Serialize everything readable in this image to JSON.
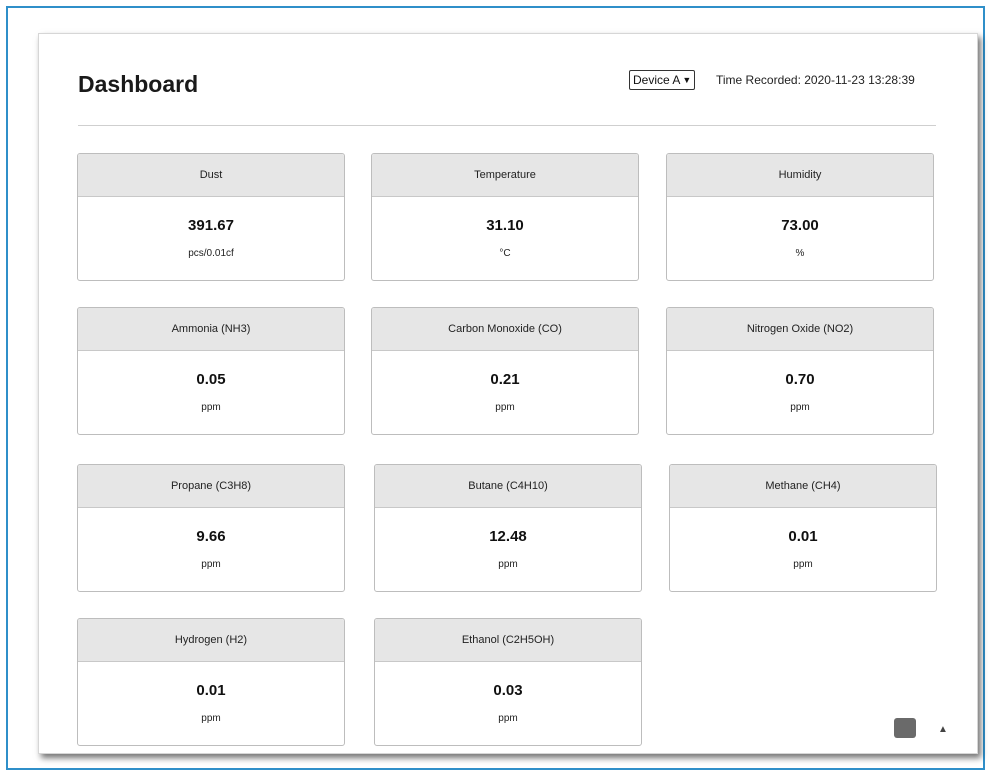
{
  "page": {
    "title": "Dashboard"
  },
  "header": {
    "device_selected": "Device A",
    "time_recorded": "Time Recorded: 2020-11-23 13:28:39"
  },
  "cards": [
    {
      "label": "Dust",
      "value": "391.67",
      "unit": "pcs/0.01cf"
    },
    {
      "label": "Temperature",
      "value": "31.10",
      "unit": "°C"
    },
    {
      "label": "Humidity",
      "value": "73.00",
      "unit": "%"
    },
    {
      "label": "Ammonia (NH3)",
      "value": "0.05",
      "unit": "ppm"
    },
    {
      "label": "Carbon Monoxide (CO)",
      "value": "0.21",
      "unit": "ppm"
    },
    {
      "label": "Nitrogen Oxide (NO2)",
      "value": "0.70",
      "unit": "ppm"
    },
    {
      "label": "Propane (C3H8)",
      "value": "9.66",
      "unit": "ppm"
    },
    {
      "label": "Butane (C4H10)",
      "value": "12.48",
      "unit": "ppm"
    },
    {
      "label": "Methane (CH4)",
      "value": "0.01",
      "unit": "ppm"
    },
    {
      "label": "Hydrogen (H2)",
      "value": "0.01",
      "unit": "ppm"
    },
    {
      "label": "Ethanol (C2H5OH)",
      "value": "0.03",
      "unit": "ppm"
    }
  ],
  "icons": {
    "scroll_top": "scroll-to-top-icon",
    "scroll_arrow": "scroll-up-arrow-icon"
  }
}
